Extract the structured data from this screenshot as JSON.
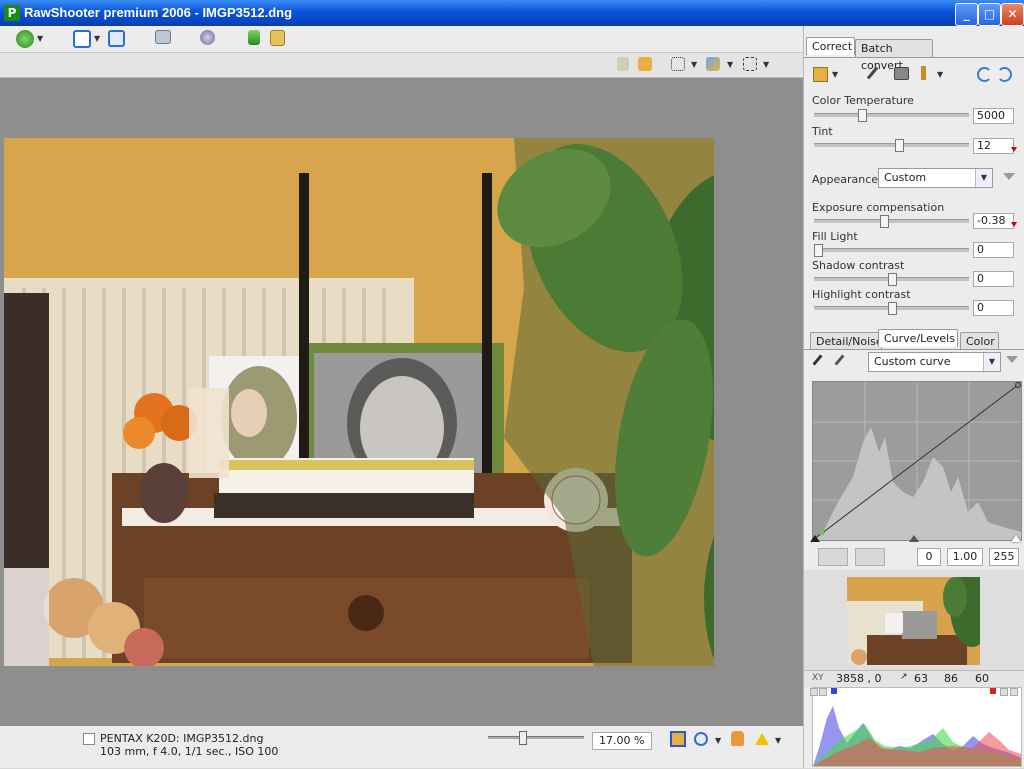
{
  "window": {
    "title": "RawShooter premium 2006 - IMGP3512.dng",
    "minimize": "_",
    "maximize": "□",
    "close": "✕"
  },
  "status": {
    "camera": "PENTAX K20D:",
    "filename": "IMGP3512.dng",
    "exif": "103 mm, f 4.0, 1/1 sec., ISO 100",
    "zoom": "17.00 %",
    "zoom_fraction": 0.35
  },
  "panel": {
    "tabs": [
      "Correct",
      "Batch convert"
    ],
    "active_tab": "Correct",
    "color_temperature": {
      "label": "Color Temperature",
      "value": "5000",
      "position": 0.3
    },
    "tint": {
      "label": "Tint",
      "value": "12",
      "position": 0.55
    },
    "appearance": {
      "label": "Appearance",
      "value": "Custom"
    },
    "exposure": {
      "label": "Exposure compensation",
      "value": "-0.38",
      "position": 0.45
    },
    "fill_light": {
      "label": "Fill Light",
      "value": "0",
      "position": 0.0
    },
    "shadow_contrast": {
      "label": "Shadow contrast",
      "value": "0",
      "position": 0.5
    },
    "highlight_contrast": {
      "label": "Highlight contrast",
      "value": "0",
      "position": 0.5
    },
    "subtabs": [
      "Detail/Noise",
      "Curve/Levels",
      "Color"
    ],
    "active_subtab": "Curve/Levels",
    "curve_preset": "Custom curve",
    "levels": {
      "black": "0",
      "gamma": "1.00",
      "white": "255"
    },
    "readout": {
      "xy_label": "XY",
      "xy": "3858 , 0",
      "r": "63",
      "g": "86",
      "b": "60"
    }
  }
}
